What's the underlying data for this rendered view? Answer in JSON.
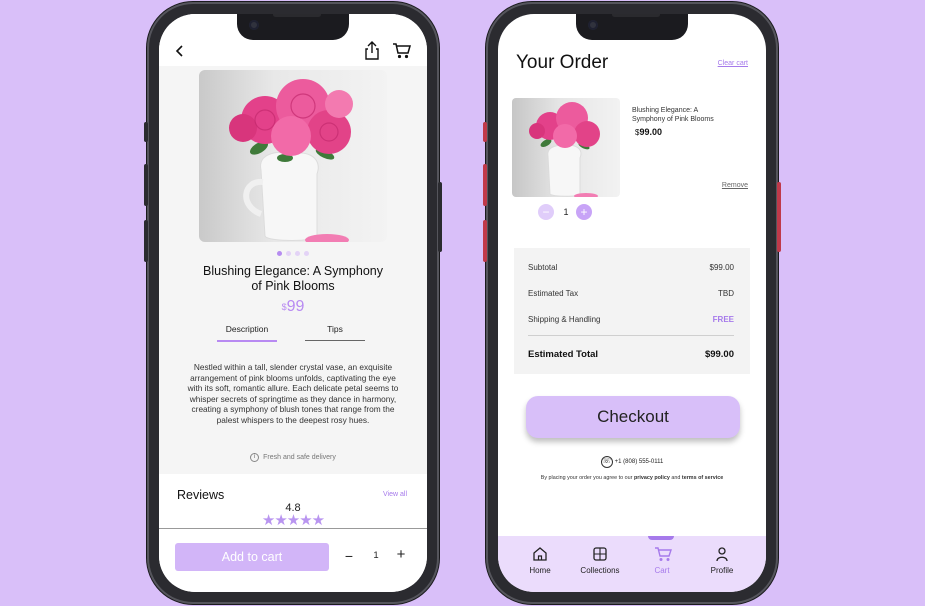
{
  "colors": {
    "background": "#d9bff9",
    "accent": "#b88af2",
    "button": "#d2b5f8"
  },
  "product_screen": {
    "title": "Blushing Elegance: A Symphony of Pink Blooms",
    "price_currency": "$",
    "price_value": "99",
    "tabs": [
      {
        "label": "Description",
        "active": true
      },
      {
        "label": "Tips",
        "active": false
      }
    ],
    "description": "Nestled within a tall, slender crystal vase, an exquisite arrangement of pink blooms unfolds, captivating the eye with its soft, romantic allure. Each delicate petal seems to whisper secrets of springtime as they dance in harmony, creating a symphony of blush tones that range from the palest whispers to the deepest rosy hues.",
    "delivery_note": "Fresh and safe delivery",
    "reviews": {
      "title": "Reviews",
      "view_all": "View all",
      "score": "4.8",
      "stars": "★★★★★"
    },
    "add_to_cart": "Add to cart",
    "qty_minus": "−",
    "quantity": "1",
    "qty_plus": "+",
    "icons": [
      "back-icon",
      "share-icon",
      "cart-icon"
    ]
  },
  "order_screen": {
    "title": "Your Order",
    "clear_cart": "Clear cart",
    "item": {
      "name": "Blushing Elegance: A Symphony of Pink Blooms",
      "price_currency": "$",
      "price_value": "99.00",
      "remove": "Remove",
      "quantity": "1"
    },
    "summary": {
      "subtotal_label": "Subtotal",
      "subtotal_value": "$99.00",
      "tax_label": "Estimated Tax",
      "tax_value": "TBD",
      "shipping_label": "Shipping & Handling",
      "shipping_value": "FREE",
      "total_label": "Estimated Total",
      "total_value": "$99.00"
    },
    "checkout": "Checkout",
    "phone": "+1 (808) 555-0111",
    "legal_prefix": "By placing your order you agree to our ",
    "legal_privacy": "privacy policy",
    "legal_and": " and ",
    "legal_terms": "terms of service",
    "nav": [
      {
        "label": "Home",
        "icon": "home-icon"
      },
      {
        "label": "Collections",
        "icon": "collections-icon"
      },
      {
        "label": "Cart",
        "icon": "cart-icon",
        "active": true
      },
      {
        "label": "Profile",
        "icon": "profile-icon"
      }
    ]
  }
}
